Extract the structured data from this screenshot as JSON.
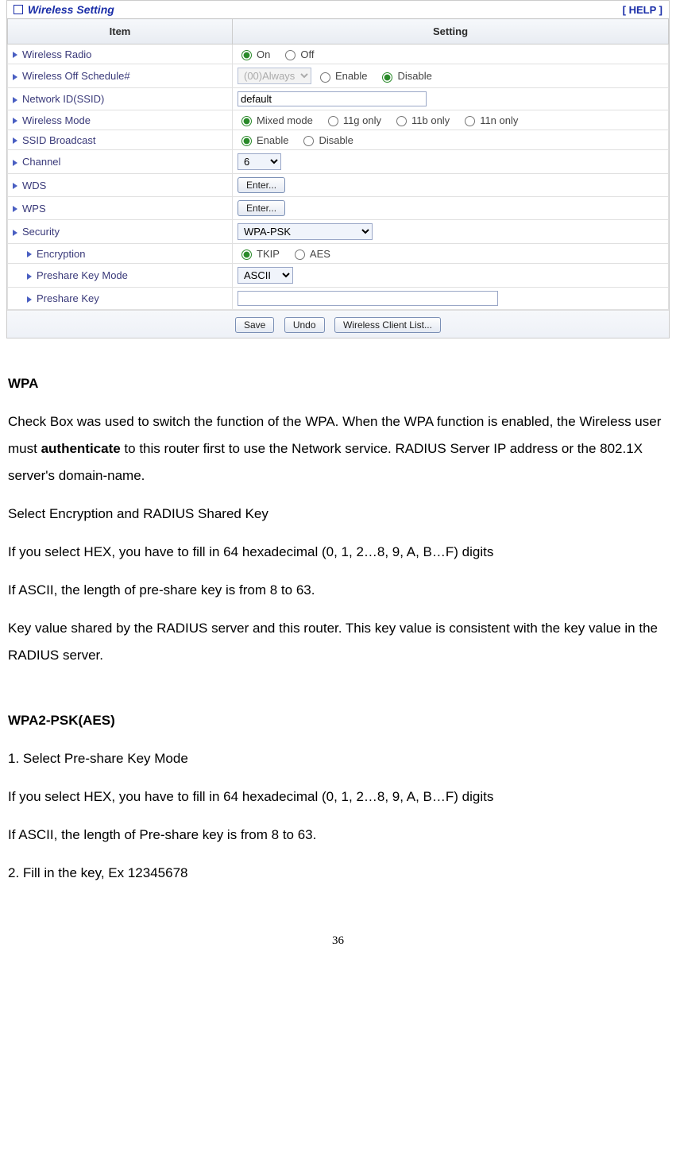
{
  "panel": {
    "title": "Wireless Setting",
    "help": "[ HELP ]"
  },
  "table": {
    "header_item": "Item",
    "header_setting": "Setting"
  },
  "rows": {
    "wireless_radio": {
      "label": "Wireless Radio",
      "on": "On",
      "off": "Off"
    },
    "wireless_off_schedule": {
      "label": "Wireless Off Schedule#",
      "select": "(00)Always",
      "enable": "Enable",
      "disable": "Disable"
    },
    "ssid": {
      "label": "Network ID(SSID)",
      "value": "default"
    },
    "wireless_mode": {
      "label": "Wireless Mode",
      "mixed": "Mixed mode",
      "g": "11g only",
      "b": "11b only",
      "n": "11n only"
    },
    "ssid_broadcast": {
      "label": "SSID Broadcast",
      "enable": "Enable",
      "disable": "Disable"
    },
    "channel": {
      "label": "Channel",
      "value": "6"
    },
    "wds": {
      "label": "WDS",
      "btn": "Enter..."
    },
    "wps": {
      "label": "WPS",
      "btn": "Enter..."
    },
    "security": {
      "label": "Security",
      "value": "WPA-PSK"
    },
    "encryption": {
      "label": "Encryption",
      "tkip": "TKIP",
      "aes": "AES"
    },
    "pskmode": {
      "label": "Preshare Key Mode",
      "value": "ASCII"
    },
    "psk": {
      "label": "Preshare Key",
      "value": ""
    }
  },
  "buttons": {
    "save": "Save",
    "undo": "Undo",
    "clients": "Wireless Client List..."
  },
  "doc": {
    "wpa_h": "WPA",
    "wpa_p1a": "Check Box was used to switch the function of the WPA. When the WPA function is enabled, the Wireless user must ",
    "wpa_auth": "authenticate",
    "wpa_p1b": " to this router first to use the Network service. RADIUS Server IP address or the 802.1X server's domain-name.",
    "wpa_p2": "Select Encryption and RADIUS Shared Key",
    "wpa_p3": "If you select HEX, you have to fill in 64 hexadecimal (0, 1, 2…8, 9, A, B…F) digits",
    "wpa_p4": "If ASCII, the length of pre-share key is from 8 to 63.",
    "wpa_p5": "Key value shared by the RADIUS server and this router. This key value is consistent with the key value in the RADIUS server.",
    "wpa2_h": "WPA2-PSK(AES)",
    "wpa2_p1": "1. Select Pre-share Key Mode",
    "wpa2_p2": "If you select HEX, you have to fill in 64 hexadecimal (0, 1, 2…8, 9, A, B…F) digits",
    "wpa2_p3": "If ASCII, the length of Pre-share key is from 8 to 63.",
    "wpa2_p4": "2. Fill in the key, Ex 12345678"
  },
  "page_number": "36"
}
